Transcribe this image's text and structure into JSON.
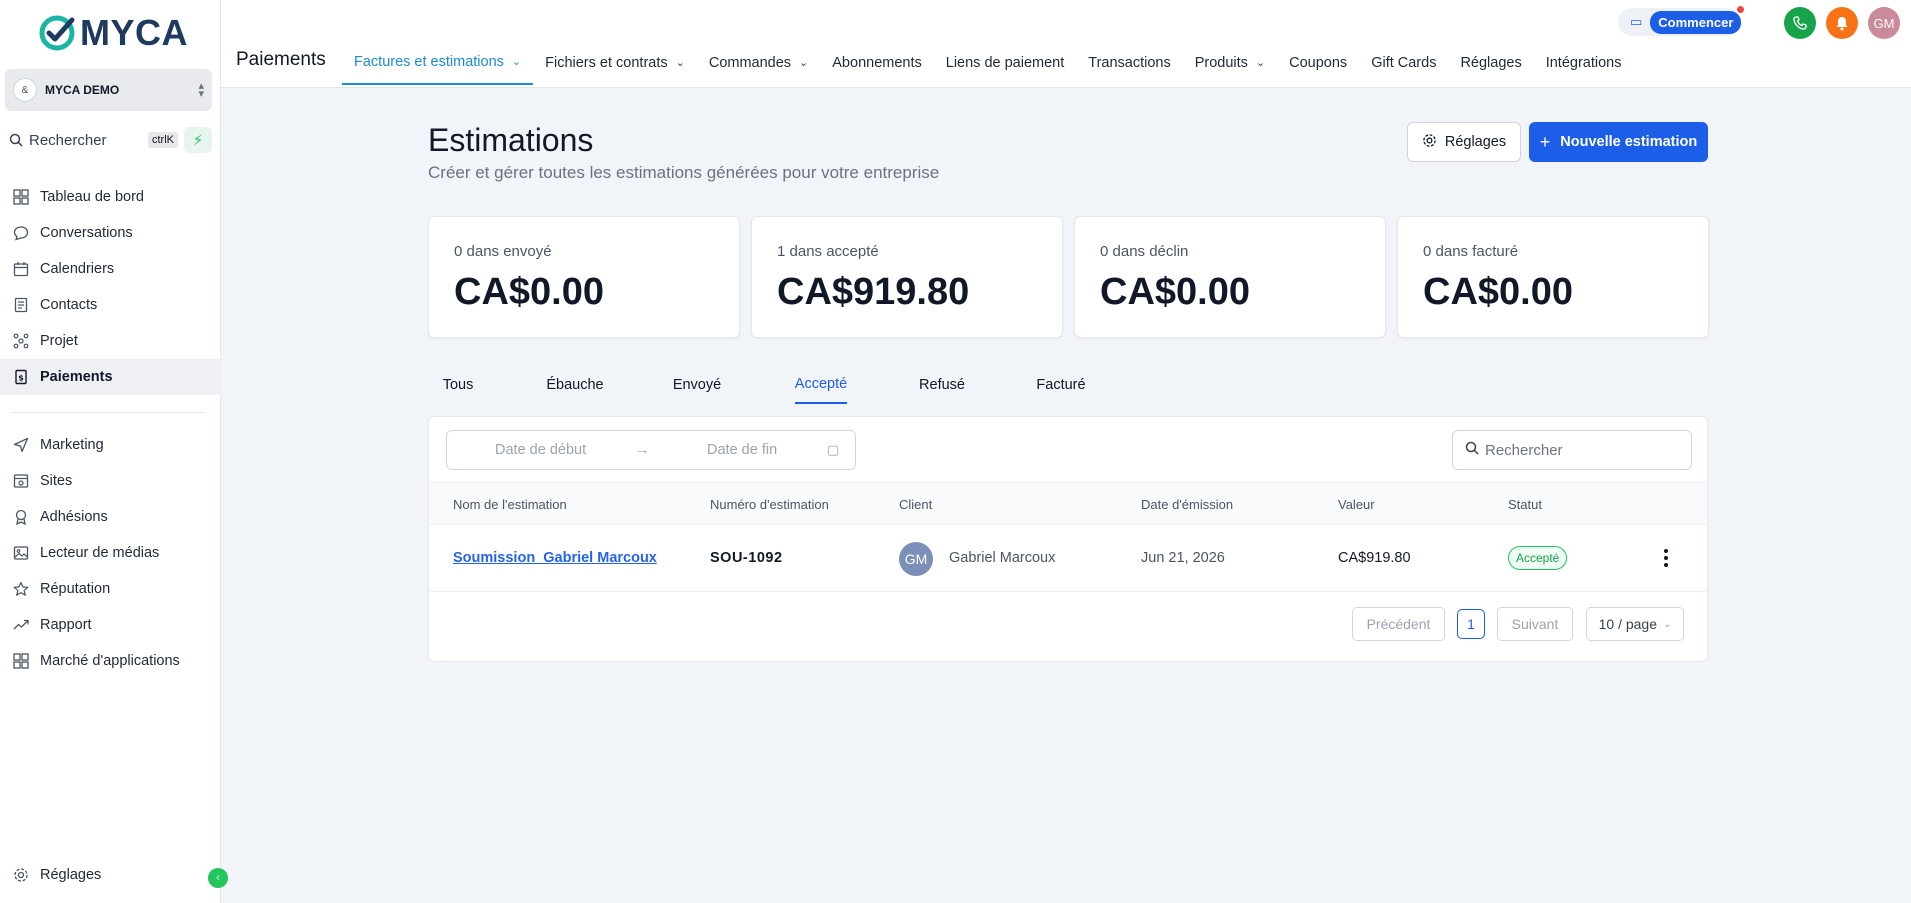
{
  "app": {
    "logo_text": "MYCA",
    "account_name": "MYCA DEMO",
    "account_initial": "&"
  },
  "sidebar": {
    "search_placeholder": "Rechercher",
    "search_shortcut": "ctrlK",
    "items": [
      {
        "label": "Tableau de bord",
        "icon": "dashboard-icon"
      },
      {
        "label": "Conversations",
        "icon": "chat-icon"
      },
      {
        "label": "Calendriers",
        "icon": "calendar-icon"
      },
      {
        "label": "Contacts",
        "icon": "contacts-icon"
      },
      {
        "label": "Projet",
        "icon": "project-icon"
      },
      {
        "label": "Paiements",
        "icon": "payments-icon",
        "active": true
      }
    ],
    "items2": [
      {
        "label": "Marketing",
        "icon": "send-icon"
      },
      {
        "label": "Sites",
        "icon": "sites-icon"
      },
      {
        "label": "Adhésions",
        "icon": "membership-icon"
      },
      {
        "label": "Lecteur de médias",
        "icon": "media-icon"
      },
      {
        "label": "Réputation",
        "icon": "star-icon"
      },
      {
        "label": "Rapport",
        "icon": "report-icon"
      },
      {
        "label": "Marché d'applications",
        "icon": "apps-icon"
      }
    ],
    "bottom": {
      "label": "Réglages",
      "icon": "gear-icon"
    }
  },
  "topbar": {
    "section_title": "Paiements",
    "tabs": [
      {
        "label": "Factures et estimations",
        "dropdown": true,
        "active": true
      },
      {
        "label": "Fichiers et contrats",
        "dropdown": true
      },
      {
        "label": "Commandes",
        "dropdown": true
      },
      {
        "label": "Abonnements"
      },
      {
        "label": "Liens de paiement"
      },
      {
        "label": "Transactions"
      },
      {
        "label": "Produits",
        "dropdown": true
      },
      {
        "label": "Coupons"
      },
      {
        "label": "Gift Cards"
      },
      {
        "label": "Réglages"
      },
      {
        "label": "Intégrations"
      }
    ],
    "start_label": "Commencer",
    "user_initials": "GM"
  },
  "page": {
    "title": "Estimations",
    "subtitle": "Créer et gérer toutes les estimations générées pour votre entreprise",
    "settings_button": "Réglages",
    "new_button": "Nouvelle estimation"
  },
  "stats": [
    {
      "label": "0 dans envoyé",
      "value": "CA$0.00"
    },
    {
      "label": "1 dans accepté",
      "value": "CA$919.80"
    },
    {
      "label": "0 dans déclin",
      "value": "CA$0.00"
    },
    {
      "label": "0 dans facturé",
      "value": "CA$0.00"
    }
  ],
  "filter_tabs": [
    {
      "label": "Tous"
    },
    {
      "label": "Ébauche"
    },
    {
      "label": "Envoyé"
    },
    {
      "label": "Accepté",
      "active": true
    },
    {
      "label": "Refusé"
    },
    {
      "label": "Facturé"
    }
  ],
  "table": {
    "date_start_placeholder": "Date de début",
    "date_end_placeholder": "Date de fin",
    "search_placeholder": "Rechercher",
    "columns": [
      "Nom de l'estimation",
      "Numéro d'estimation",
      "Client",
      "Date d'émission",
      "Valeur",
      "Statut"
    ],
    "rows": [
      {
        "name": "Soumission_Gabriel Marcoux",
        "number": "SOU-1092",
        "client_initials": "GM",
        "client": "Gabriel Marcoux",
        "date": "Jun 21, 2026",
        "value": "CA$919.80",
        "status": "Accepté"
      }
    ],
    "pagination": {
      "prev": "Précédent",
      "page": "1",
      "next": "Suivant",
      "page_size": "10 / page"
    }
  },
  "colors": {
    "primary": "#1d5ee8",
    "active_tab": "#1a8bd4",
    "success": "#22c55e",
    "logo_teal": "#1bb5a3",
    "logo_navy": "#1e3a5f"
  }
}
